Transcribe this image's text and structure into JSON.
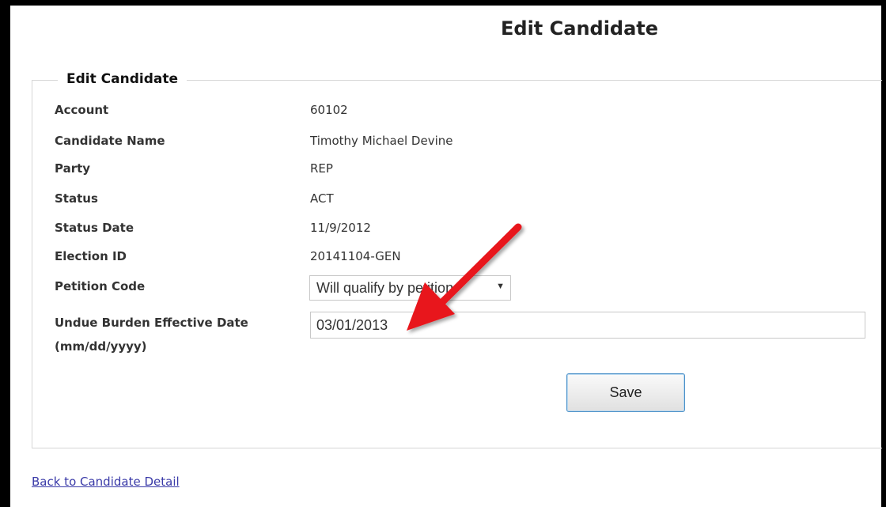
{
  "page": {
    "title": "Edit Candidate"
  },
  "form": {
    "legend": "Edit Candidate",
    "rows": [
      {
        "label": "Account",
        "value": "60102"
      },
      {
        "label": "Candidate Name",
        "value": "Timothy Michael Devine"
      },
      {
        "label": "Party",
        "value": "REP"
      },
      {
        "label": "Status",
        "value": "ACT"
      },
      {
        "label": "Status Date",
        "value": "11/9/2012"
      },
      {
        "label": "Election ID",
        "value": "20141104-GEN"
      }
    ],
    "petition": {
      "label": "Petition Code",
      "selected": "Will qualify by petition"
    },
    "undue_burden": {
      "label_line1": "Undue Burden Effective Date",
      "label_line2": "(mm/dd/yyyy)",
      "value": "03/01/2013"
    },
    "save_label": "Save"
  },
  "footer": {
    "back_link": "Back to Candidate Detail"
  },
  "colors": {
    "annotation_arrow": "#e8191f",
    "link": "#3a3aa8",
    "button_border": "#4a90c8"
  },
  "icons": {
    "select_caret": "chevron-down-icon",
    "annotation": "red-arrow-annotation"
  }
}
